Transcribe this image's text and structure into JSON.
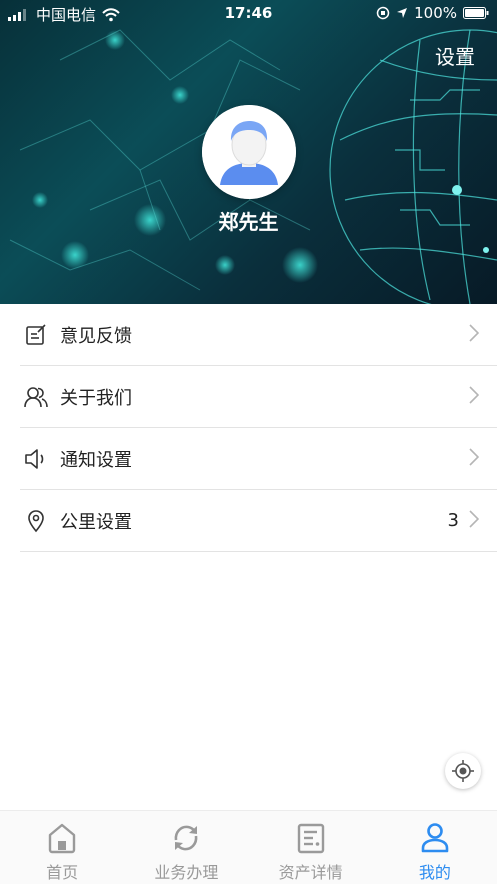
{
  "status_bar": {
    "carrier": "中国电信",
    "time": "17:46",
    "battery": "100%"
  },
  "header": {
    "settings_label": "设置",
    "username": "郑先生"
  },
  "menu": [
    {
      "label": "意见反馈",
      "icon": "feedback-icon"
    },
    {
      "label": "关于我们",
      "icon": "users-icon"
    },
    {
      "label": "通知设置",
      "icon": "speaker-icon"
    },
    {
      "label": "公里设置",
      "icon": "location-pin-icon",
      "value": "3"
    }
  ],
  "tabs": [
    {
      "label": "首页",
      "icon": "home-icon",
      "active": false
    },
    {
      "label": "业务办理",
      "icon": "refresh-icon",
      "active": false
    },
    {
      "label": "资产详情",
      "icon": "document-icon",
      "active": false
    },
    {
      "label": "我的",
      "icon": "person-icon",
      "active": true
    }
  ],
  "colors": {
    "accent": "#2d8cf0",
    "inactive": "#9a9a9a",
    "header_bg": "#0b4d57"
  }
}
